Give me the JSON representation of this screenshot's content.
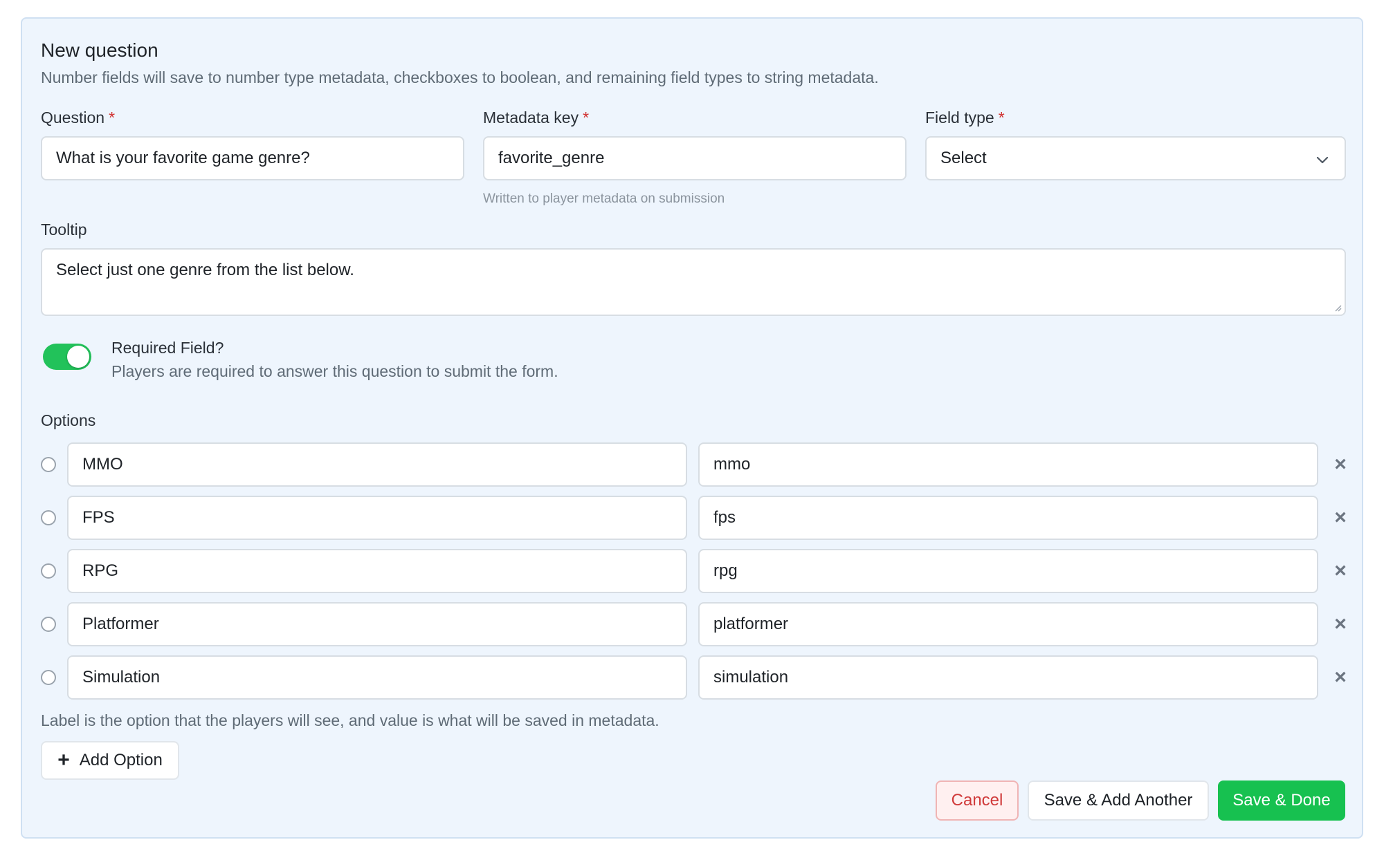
{
  "form": {
    "title": "New question",
    "subtitle": "Number fields will save to number type metadata, checkboxes to boolean, and remaining field types to string metadata.",
    "required_mark": "*"
  },
  "question": {
    "label": "Question",
    "value": "What is your favorite game genre?"
  },
  "metadata_key": {
    "label": "Metadata key",
    "value": "favorite_genre",
    "hint": "Written to player metadata on submission"
  },
  "field_type": {
    "label": "Field type",
    "value": "Select",
    "icon": "chevron-down-icon"
  },
  "tooltip": {
    "label": "Tooltip",
    "value": "Select just one genre from the list below."
  },
  "required_field": {
    "label": "Required Field?",
    "description": "Players are required to answer this question to submit the form.",
    "enabled": true,
    "color": "#22c25a"
  },
  "options": {
    "label": "Options",
    "items": [
      {
        "label": "MMO",
        "value": "mmo"
      },
      {
        "label": "FPS",
        "value": "fps"
      },
      {
        "label": "RPG",
        "value": "rpg"
      },
      {
        "label": "Platformer",
        "value": "platformer"
      },
      {
        "label": "Simulation",
        "value": "simulation"
      }
    ],
    "remove_icon": "close-icon",
    "hint": "Label is the option that the players will see, and value is what will be saved in metadata.",
    "add_label": "Add Option"
  },
  "actions": {
    "cancel_label": "Cancel",
    "save_another_label": "Save & Add Another",
    "save_done_label": "Save & Done",
    "primary_color": "#17c150",
    "danger_color": "#d03a3a"
  }
}
